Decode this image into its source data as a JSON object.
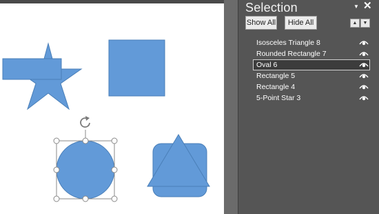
{
  "selection_pane": {
    "title": "Selection",
    "show_all_label": "Show All",
    "hide_all_label": "Hide All",
    "items": [
      {
        "label": "Isosceles Triangle 8",
        "visible": true,
        "selected": false
      },
      {
        "label": "Rounded Rectangle 7",
        "visible": true,
        "selected": false
      },
      {
        "label": "Oval 6",
        "visible": true,
        "selected": true
      },
      {
        "label": "Rectangle 5",
        "visible": true,
        "selected": false
      },
      {
        "label": "Rectangle 4",
        "visible": true,
        "selected": false
      },
      {
        "label": "5-Point Star 3",
        "visible": true,
        "selected": false
      }
    ]
  },
  "slide": {
    "shape_fill": "#629ad8",
    "shape_stroke": "#4a7fb8"
  },
  "icons": {
    "pane_dropdown": "chevron-down-icon",
    "pane_close": "close-icon",
    "bring_forward": "arrow-up-icon",
    "send_backward": "arrow-down-icon",
    "visibility": "eye-icon",
    "rotate_handle": "rotate-icon"
  }
}
